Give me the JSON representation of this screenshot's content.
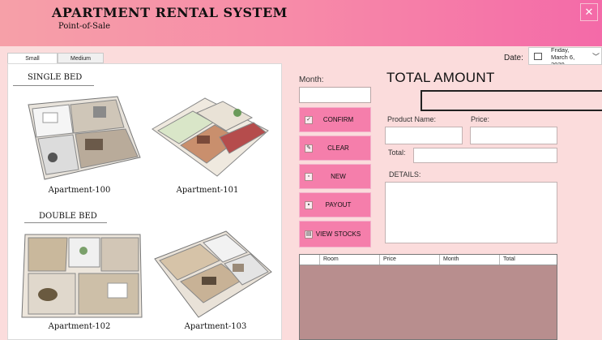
{
  "header": {
    "title": "APARTMENT RENTAL SYSTEM",
    "subtitle": "Point-of-Sale",
    "close_icon": "close-icon"
  },
  "tabs": [
    {
      "label": "Small",
      "active": true
    },
    {
      "label": "Medium",
      "active": false
    }
  ],
  "sections": {
    "single": "SINGLE BED",
    "double": "DOUBLE BED"
  },
  "apartments": [
    {
      "label": "Apartment-100"
    },
    {
      "label": "Apartment-101"
    },
    {
      "label": "Apartment-102"
    },
    {
      "label": "Apartment-103"
    }
  ],
  "month": {
    "label": "Month:",
    "value": ""
  },
  "buttons": [
    {
      "label": "CONFIRM",
      "icon": "check-icon"
    },
    {
      "label": "CLEAR",
      "icon": "clear-icon"
    },
    {
      "label": "NEW",
      "icon": "new-icon"
    },
    {
      "label": "PAYOUT",
      "icon": "payout-icon"
    },
    {
      "label": "VIEW STOCKS",
      "icon": "stocks-icon"
    }
  ],
  "date": {
    "label": "Date:",
    "line1": "Friday,",
    "line2": "March 6,",
    "line3": "2020"
  },
  "total_amount": {
    "title": "TOTAL AMOUNT",
    "value": ""
  },
  "fields": {
    "product_name": "Product Name:",
    "price": "Price:",
    "total": "Total:",
    "details": "DETAILS:"
  },
  "table": {
    "columns": [
      "Room",
      "Price",
      "Month",
      "Total"
    ]
  },
  "colors": {
    "header_start": "#f6a0a8",
    "header_end": "#f46aa8",
    "button": "#f57eab",
    "background": "#fbdcdc",
    "grid": "#b88e8e"
  }
}
